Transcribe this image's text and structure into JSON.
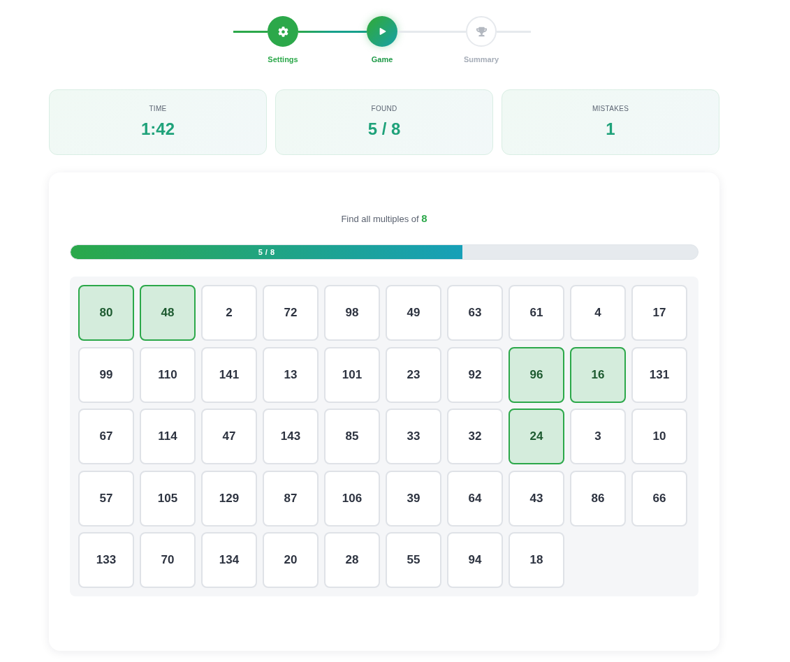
{
  "stepper": {
    "steps": [
      {
        "label": "Settings",
        "completed": true,
        "selected": false
      },
      {
        "label": "Game",
        "completed": false,
        "selected": true
      },
      {
        "label": "Summary",
        "completed": false,
        "selected": false
      }
    ]
  },
  "stats": [
    {
      "label": "TIME",
      "value": "1:42"
    },
    {
      "label": "FOUND",
      "value": "5 / 8"
    },
    {
      "label": "MISTAKES",
      "value": "1"
    }
  ],
  "game": {
    "prompt": "Find all multiples of **8**",
    "progress": {
      "level": 0.625,
      "label": "5 / 8"
    },
    "cells": [
      {
        "number": "80",
        "selected": true
      },
      {
        "number": "48",
        "selected": true
      },
      {
        "number": "2",
        "selected": false
      },
      {
        "number": "72",
        "selected": false
      },
      {
        "number": "98",
        "selected": false
      },
      {
        "number": "49",
        "selected": false
      },
      {
        "number": "63",
        "selected": false
      },
      {
        "number": "61",
        "selected": false
      },
      {
        "number": "4",
        "selected": false
      },
      {
        "number": "17",
        "selected": false
      },
      {
        "number": "99",
        "selected": false
      },
      {
        "number": "110",
        "selected": false
      },
      {
        "number": "141",
        "selected": false
      },
      {
        "number": "13",
        "selected": false
      },
      {
        "number": "101",
        "selected": false
      },
      {
        "number": "23",
        "selected": false
      },
      {
        "number": "92",
        "selected": false
      },
      {
        "number": "96",
        "selected": true
      },
      {
        "number": "16",
        "selected": true
      },
      {
        "number": "131",
        "selected": false
      },
      {
        "number": "67",
        "selected": false
      },
      {
        "number": "114",
        "selected": false
      },
      {
        "number": "47",
        "selected": false
      },
      {
        "number": "143",
        "selected": false
      },
      {
        "number": "85",
        "selected": false
      },
      {
        "number": "33",
        "selected": false
      },
      {
        "number": "32",
        "selected": false
      },
      {
        "number": "24",
        "selected": true
      },
      {
        "number": "3",
        "selected": false
      },
      {
        "number": "10",
        "selected": false
      },
      {
        "number": "57",
        "selected": false
      },
      {
        "number": "105",
        "selected": false
      },
      {
        "number": "129",
        "selected": false
      },
      {
        "number": "87",
        "selected": false
      },
      {
        "number": "106",
        "selected": false
      },
      {
        "number": "39",
        "selected": false
      },
      {
        "number": "64",
        "selected": false
      },
      {
        "number": "43",
        "selected": false
      },
      {
        "number": "86",
        "selected": false
      },
      {
        "number": "66",
        "selected": false
      },
      {
        "number": "133",
        "selected": false
      },
      {
        "number": "70",
        "selected": false
      },
      {
        "number": "134",
        "selected": false
      },
      {
        "number": "20",
        "selected": false
      },
      {
        "number": "28",
        "selected": false
      },
      {
        "number": "55",
        "selected": false
      },
      {
        "number": "94",
        "selected": false
      },
      {
        "number": "18",
        "selected": false
      }
    ]
  }
}
